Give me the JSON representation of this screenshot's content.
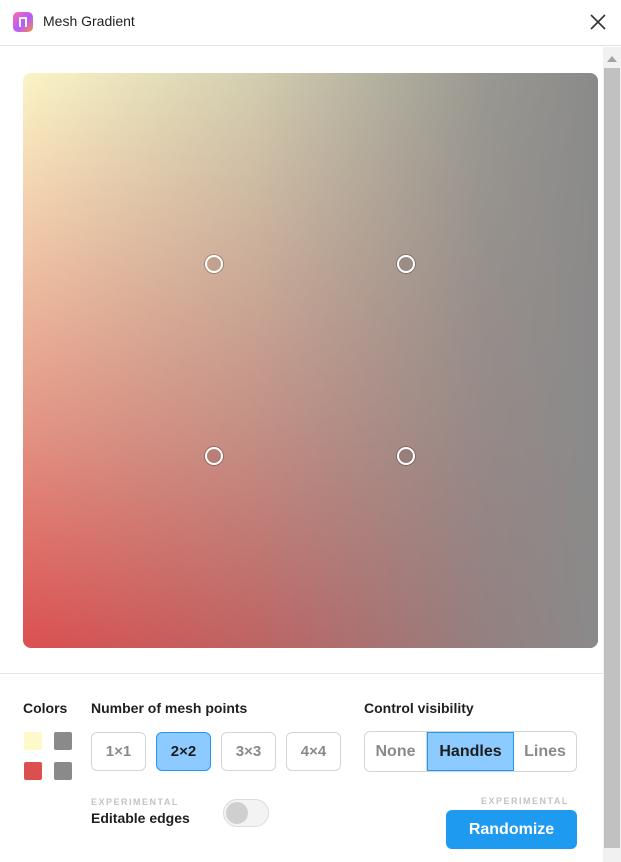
{
  "window": {
    "title": "Mesh Gradient",
    "app_icon": "mesh-gradient-app-icon",
    "close_icon": "close-icon"
  },
  "canvas": {
    "mesh_points": "2×2",
    "colors": {
      "top_left": "#FBF4C6",
      "top_right": "#8A8A8A",
      "bottom_left": "#DB4F4F",
      "bottom_right": "#8A8A8A"
    }
  },
  "colors_section": {
    "label": "Colors",
    "swatches": [
      "#FFF8C8",
      "#8A8A8A",
      "#DB4F4F",
      "#8A8A8A"
    ]
  },
  "mesh_points_section": {
    "label": "Number of mesh points",
    "options": [
      "1×1",
      "2×2",
      "3×3",
      "4×4"
    ],
    "selected": "2×2"
  },
  "visibility_section": {
    "label": "Control visibility",
    "options": [
      "None",
      "Handles",
      "Lines"
    ],
    "selected": "Handles"
  },
  "editable_edges": {
    "tag": "EXPERIMENTAL",
    "label": "Editable edges",
    "enabled": false
  },
  "randomize": {
    "tag": "EXPERIMENTAL",
    "label": "Randomize"
  },
  "accent_color": "#1E9BF0"
}
